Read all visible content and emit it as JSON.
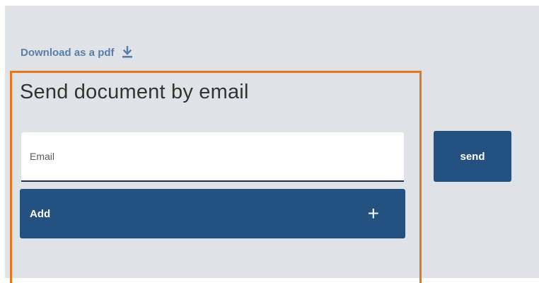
{
  "download": {
    "label": "Download as a pdf",
    "icon": "download-icon"
  },
  "email_section": {
    "title": "Send document by email",
    "email_placeholder": "Email",
    "email_value": "",
    "add_label": "Add",
    "add_icon": "+",
    "send_label": "send"
  },
  "colors": {
    "background": "#dfe3e8",
    "accent": "#235280",
    "link": "#5a7ea6",
    "focus_outline": "#e8761c"
  }
}
